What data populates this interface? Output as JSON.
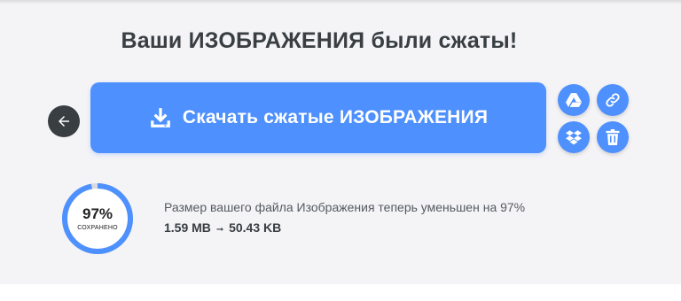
{
  "header": {
    "title": "Ваши ИЗОБРАЖЕНИЯ были сжаты!"
  },
  "actions": {
    "back_icon": "arrow-left-icon",
    "download_label": "Скачать сжатые ИЗОБРАЖЕНИЯ",
    "download_icon": "download-icon",
    "share_buttons": [
      {
        "name": "google-drive",
        "icon": "google-drive-icon"
      },
      {
        "name": "copy-link",
        "icon": "link-icon"
      },
      {
        "name": "dropbox",
        "icon": "dropbox-icon"
      },
      {
        "name": "delete",
        "icon": "trash-icon"
      }
    ]
  },
  "result": {
    "percent_label": "97%",
    "percent_value": 97,
    "saved_caption": "СОХРАНЕНО",
    "summary_text": "Размер вашего файла Изображения теперь уменьшен на 97%",
    "original_size": "1.59 MB",
    "arrow": "➞",
    "compressed_size": "50.43 KB"
  },
  "colors": {
    "accent": "#4d90fe",
    "dark": "#383e42",
    "panel_background": "#f4f3f6",
    "ring_track": "#d9dbe0"
  }
}
